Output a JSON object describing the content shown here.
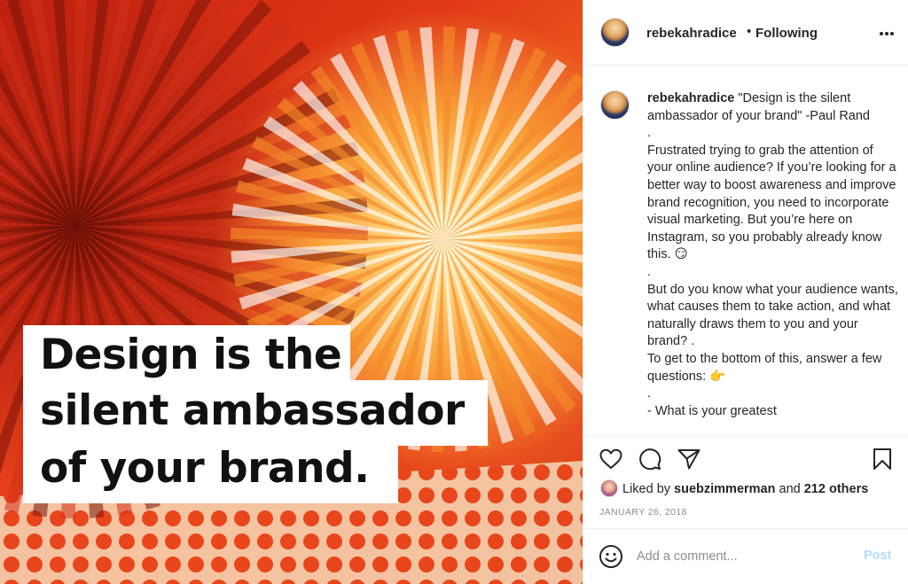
{
  "post": {
    "image_caption_lines": [
      "Design is the",
      "silent ambassador",
      "of your brand."
    ]
  },
  "header": {
    "username": "rebekahradice",
    "separator": "•",
    "follow_status": "Following"
  },
  "caption": {
    "username": "rebekahradice",
    "text": " \"Design is the silent ambassador of your brand\" -Paul Rand\n.\nFrustrated trying to grab the attention of your online audience? If you’re looking for a better way to boost awareness and improve brand recognition, you need to incorporate visual marketing. But you’re here on Instagram, so you probably already know this. 😏\n.\nBut do you know what your audience wants, what causes them to take action, and what naturally draws them to you and your brand? .\nTo get to the bottom of this, answer a few questions: 👉\n.\n- What is your greatest"
  },
  "likes": {
    "prefix": "Liked by ",
    "user": "suebzimmerman",
    "middle": " and ",
    "count": "212 others"
  },
  "date": "JANUARY 26, 2018",
  "comment": {
    "placeholder": "Add a comment...",
    "post_label": "Post"
  },
  "icons": {
    "more": "more-options-icon",
    "like": "heart-icon",
    "comment": "comment-bubble-icon",
    "share": "paper-plane-icon",
    "save": "bookmark-icon",
    "emoji": "smiley-icon"
  },
  "colors": {
    "post_button": "#b3dbff",
    "date": "#8e8e8e",
    "text": "#262626"
  }
}
